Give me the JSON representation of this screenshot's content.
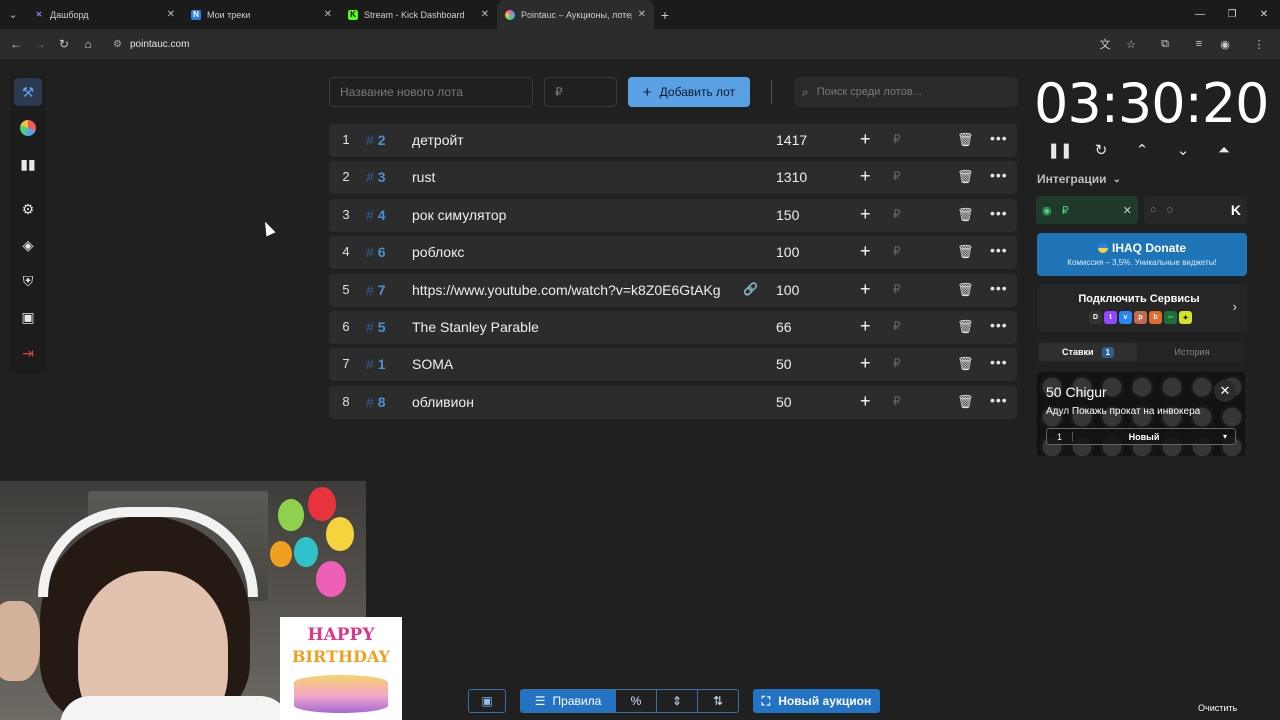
{
  "browser": {
    "tabs": [
      {
        "title": "Дашборд",
        "favicon": "X",
        "color": "#8f7cff"
      },
      {
        "title": "Мои треки",
        "favicon": "N",
        "color": "#2f7ee6"
      },
      {
        "title": "Stream - Kick Dashboard",
        "favicon": "K",
        "color": "#53fc18"
      },
      {
        "title": "Pointauc – Аукционы, лотереи",
        "favicon": "P",
        "color": "#e85d9a"
      }
    ],
    "active_tab": 3,
    "url": "pointauc.com"
  },
  "form": {
    "lot_name_placeholder": "Название нового лота",
    "amount_placeholder": "₽",
    "add_button": "Добавить лот",
    "search_placeholder": "Поиск среди лотов..."
  },
  "lots": [
    {
      "pos": "1",
      "id": "2",
      "name": "детройт",
      "amount": "1417",
      "has_link": false
    },
    {
      "pos": "2",
      "id": "3",
      "name": "rust",
      "amount": "1310",
      "has_link": false
    },
    {
      "pos": "3",
      "id": "4",
      "name": "рок симулятор",
      "amount": "150",
      "has_link": false
    },
    {
      "pos": "4",
      "id": "6",
      "name": "роблокс",
      "amount": "100",
      "has_link": false
    },
    {
      "pos": "5",
      "id": "7",
      "name": "https://www.youtube.com/watch?v=k8Z0E6GtAKg",
      "amount": "100",
      "has_link": true
    },
    {
      "pos": "6",
      "id": "5",
      "name": "The Stanley Parable",
      "amount": "66",
      "has_link": false
    },
    {
      "pos": "7",
      "id": "1",
      "name": "SOMA",
      "amount": "50",
      "has_link": false
    },
    {
      "pos": "8",
      "id": "8",
      "name": "обливион",
      "amount": "50",
      "has_link": false
    }
  ],
  "currency_symbol": "₽",
  "timer": {
    "value": "03:30:20"
  },
  "integrations": {
    "label": "Интеграции",
    "card1_currency": "₽",
    "donate_title": "IHAQ Donate",
    "donate_subtitle": "Комиссия – 3,5%. Уникальные виджеты!",
    "connect_services": "Подключить Сервисы"
  },
  "bets_panel": {
    "tab_bets": "Ставки",
    "tab_bets_count": "1",
    "tab_history": "История",
    "bet": {
      "user": "50 Chigur",
      "message": "Адул Покажь прокат на инвокера",
      "index": "1",
      "select_value": "Новый"
    }
  },
  "stream_overlay": {
    "birthday_line1": "HAPPY",
    "birthday_line2": "BIRTHDAY"
  },
  "bottom_bar": {
    "rules": "Правила",
    "percent": "%",
    "new_auction": "Новый аукцион",
    "clear": "Очистить"
  },
  "colors": {
    "accent": "#59a1e4",
    "lot_id": "#4d8fd1",
    "danger": "#d24a3c"
  }
}
